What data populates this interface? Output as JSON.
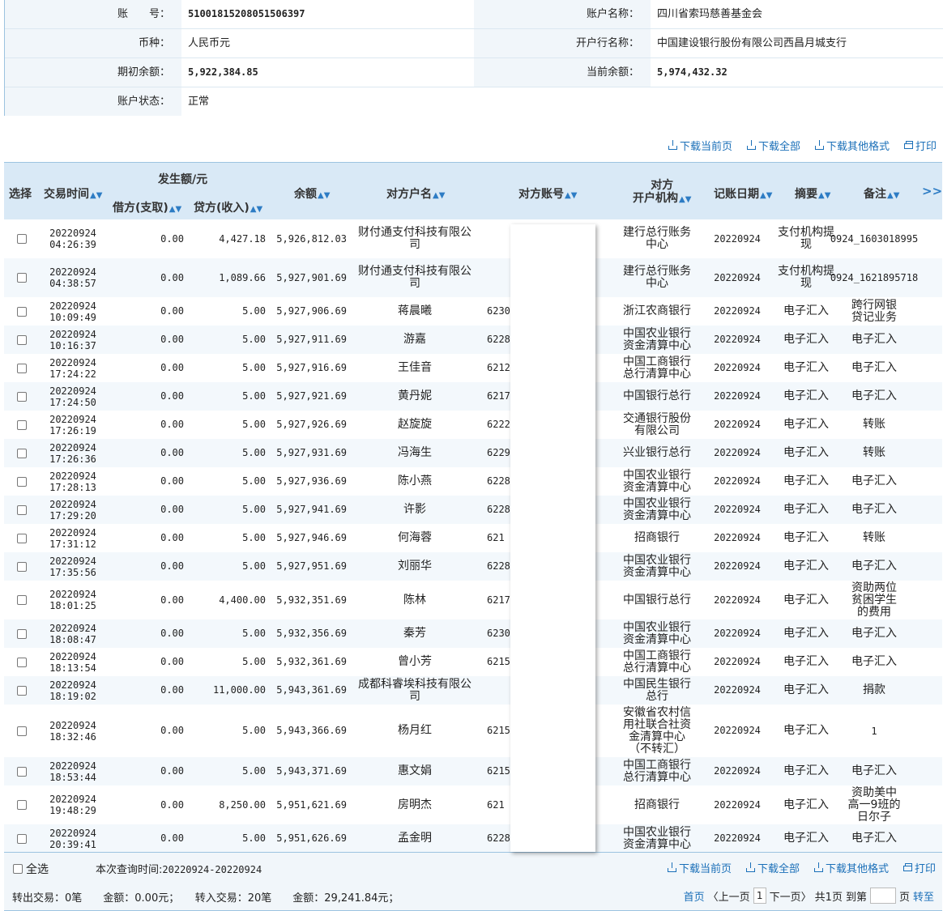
{
  "account": {
    "number_label": "账　　号：",
    "number": "51001815208051506397",
    "name_label": "账户名称：",
    "name": "四川省索玛慈善基金会",
    "currency_label": "币种：",
    "currency": "人民币元",
    "bank_label": "开户行名称：",
    "bank": "中国建设银行股份有限公司西昌月城支行",
    "opening_label": "期初余额：",
    "opening": "5,922,384.85",
    "current_label": "当前余额：",
    "current": "5,974,432.32",
    "status_label": "账户状态：",
    "status": "正常"
  },
  "actions": {
    "download_page": "下载当前页",
    "download_all": "下载全部",
    "download_other": "下载其他格式",
    "print": "打印"
  },
  "table": {
    "headers": {
      "select": "选择",
      "time": "交易时间",
      "amount_group": "发生额/元",
      "debit": "借方(支取)",
      "credit": "贷方(收入)",
      "balance": "余额",
      "party_name": "对方户名",
      "party_account": "对方账号",
      "party_bank_1": "对方",
      "party_bank_2": "开户机构",
      "post_date": "记账日期",
      "summary": "摘要",
      "note": "备注",
      "more": ">>"
    },
    "rows": [
      {
        "d": "20220924",
        "t": "04:26:39",
        "debit": "0.00",
        "credit": "4,427.18",
        "bal": "5,926,812.03",
        "name": "财付通支付科技有限公司",
        "acct": "",
        "bank": "建行总行账务中心",
        "date": "20220924",
        "sum": "支付机构提现",
        "note": "0924_1603018995"
      },
      {
        "d": "20220924",
        "t": "04:38:57",
        "debit": "0.00",
        "credit": "1,089.66",
        "bal": "5,927,901.69",
        "name": "财付通支付科技有限公司",
        "acct": "",
        "bank": "建行总行账务中心",
        "date": "20220924",
        "sum": "支付机构提现",
        "note": "0924_1621895718"
      },
      {
        "d": "20220924",
        "t": "10:09:49",
        "debit": "0.00",
        "credit": "5.00",
        "bal": "5,927,906.69",
        "name": "蒋晨曦",
        "acct": "6230",
        "bank": "浙江农商银行",
        "date": "20220924",
        "sum": "电子汇入",
        "note": "跨行网银贷记业务"
      },
      {
        "d": "20220924",
        "t": "10:16:37",
        "debit": "0.00",
        "credit": "5.00",
        "bal": "5,927,911.69",
        "name": "游嘉",
        "acct": "6228",
        "bank": "中国农业银行资金清算中心",
        "date": "20220924",
        "sum": "电子汇入",
        "note": "电子汇入"
      },
      {
        "d": "20220924",
        "t": "17:24:22",
        "debit": "0.00",
        "credit": "5.00",
        "bal": "5,927,916.69",
        "name": "王佳音",
        "acct": "6212",
        "bank": "中国工商银行总行清算中心",
        "date": "20220924",
        "sum": "电子汇入",
        "note": "电子汇入"
      },
      {
        "d": "20220924",
        "t": "17:24:50",
        "debit": "0.00",
        "credit": "5.00",
        "bal": "5,927,921.69",
        "name": "黄丹妮",
        "acct": "6217",
        "bank": "中国银行总行",
        "date": "20220924",
        "sum": "电子汇入",
        "note": "电子汇入"
      },
      {
        "d": "20220924",
        "t": "17:26:19",
        "debit": "0.00",
        "credit": "5.00",
        "bal": "5,927,926.69",
        "name": "赵旋旋",
        "acct": "6222",
        "bank": "交通银行股份有限公司",
        "date": "20220924",
        "sum": "电子汇入",
        "note": "转账"
      },
      {
        "d": "20220924",
        "t": "17:26:36",
        "debit": "0.00",
        "credit": "5.00",
        "bal": "5,927,931.69",
        "name": "冯海生",
        "acct": "6229",
        "bank": "兴业银行总行",
        "date": "20220924",
        "sum": "电子汇入",
        "note": "转账"
      },
      {
        "d": "20220924",
        "t": "17:28:13",
        "debit": "0.00",
        "credit": "5.00",
        "bal": "5,927,936.69",
        "name": "陈小燕",
        "acct": "6228",
        "bank": "中国农业银行资金清算中心",
        "date": "20220924",
        "sum": "电子汇入",
        "note": "电子汇入"
      },
      {
        "d": "20220924",
        "t": "17:29:20",
        "debit": "0.00",
        "credit": "5.00",
        "bal": "5,927,941.69",
        "name": "许影",
        "acct": "6228",
        "bank": "中国农业银行资金清算中心",
        "date": "20220924",
        "sum": "电子汇入",
        "note": "电子汇入"
      },
      {
        "d": "20220924",
        "t": "17:31:12",
        "debit": "0.00",
        "credit": "5.00",
        "bal": "5,927,946.69",
        "name": "何海蓉",
        "acct": "621",
        "bank": "招商银行",
        "date": "20220924",
        "sum": "电子汇入",
        "note": "转账"
      },
      {
        "d": "20220924",
        "t": "17:35:56",
        "debit": "0.00",
        "credit": "5.00",
        "bal": "5,927,951.69",
        "name": "刘丽华",
        "acct": "6228",
        "bank": "中国农业银行资金清算中心",
        "date": "20220924",
        "sum": "电子汇入",
        "note": "电子汇入"
      },
      {
        "d": "20220924",
        "t": "18:01:25",
        "debit": "0.00",
        "credit": "4,400.00",
        "bal": "5,932,351.69",
        "name": "陈林",
        "acct": "6217",
        "bank": "中国银行总行",
        "date": "20220924",
        "sum": "电子汇入",
        "note": "资助两位贫困学生的费用"
      },
      {
        "d": "20220924",
        "t": "18:08:47",
        "debit": "0.00",
        "credit": "5.00",
        "bal": "5,932,356.69",
        "name": "秦芳",
        "acct": "6230",
        "bank": "中国农业银行资金清算中心",
        "date": "20220924",
        "sum": "电子汇入",
        "note": "电子汇入"
      },
      {
        "d": "20220924",
        "t": "18:13:54",
        "debit": "0.00",
        "credit": "5.00",
        "bal": "5,932,361.69",
        "name": "曾小芳",
        "acct": "6215",
        "bank": "中国工商银行总行清算中心",
        "date": "20220924",
        "sum": "电子汇入",
        "note": "电子汇入"
      },
      {
        "d": "20220924",
        "t": "18:19:02",
        "debit": "0.00",
        "credit": "11,000.00",
        "bal": "5,943,361.69",
        "name": "成都科睿埃科技有限公司",
        "acct": "",
        "bank": "中国民生银行总行",
        "date": "20220924",
        "sum": "电子汇入",
        "note": "捐款"
      },
      {
        "d": "20220924",
        "t": "18:32:46",
        "debit": "0.00",
        "credit": "5.00",
        "bal": "5,943,366.69",
        "name": "杨月红",
        "acct": "6215",
        "bank": "安徽省农村信用社联合社资金清算中心（不转汇）",
        "date": "20220924",
        "sum": "电子汇入",
        "note": "1"
      },
      {
        "d": "20220924",
        "t": "18:53:44",
        "debit": "0.00",
        "credit": "5.00",
        "bal": "5,943,371.69",
        "name": "惠文娟",
        "acct": "6215",
        "bank": "中国工商银行总行清算中心",
        "date": "20220924",
        "sum": "电子汇入",
        "note": "电子汇入"
      },
      {
        "d": "20220924",
        "t": "19:48:29",
        "debit": "0.00",
        "credit": "8,250.00",
        "bal": "5,951,621.69",
        "name": "房明杰",
        "acct": "621",
        "bank": "招商银行",
        "date": "20220924",
        "sum": "电子汇入",
        "note": "资助美中高一9班的日尔子"
      },
      {
        "d": "20220924",
        "t": "20:39:41",
        "debit": "0.00",
        "credit": "5.00",
        "bal": "5,951,626.69",
        "name": "孟金明",
        "acct": "6228",
        "bank": "中国农业银行资金清算中心",
        "date": "20220924",
        "sum": "电子汇入",
        "note": "电子汇入"
      }
    ]
  },
  "footer": {
    "select_all": "全选",
    "query_time_label": "本次查询时间:",
    "query_time": "20220924-20220924",
    "summary": "转出交易：0笔　　金额：0.00元；　　转入交易：20笔　　金额：29,241.84元；",
    "first": "首页",
    "prev": "〈上一页",
    "current_page": "1",
    "next": "下一页〉",
    "total": "共1页",
    "goto_label": "到第",
    "page_unit": "页",
    "goto": "转至"
  }
}
